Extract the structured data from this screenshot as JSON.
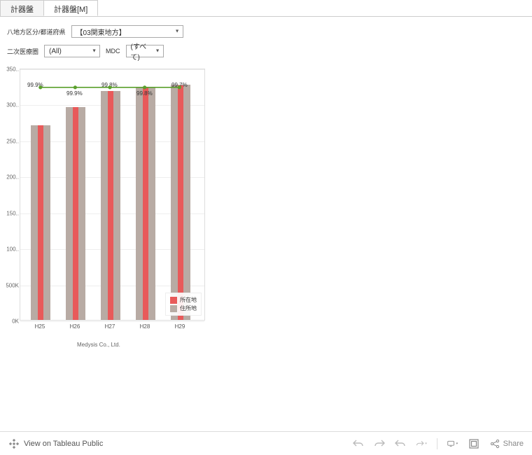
{
  "tabs": [
    {
      "label": "計器盤",
      "active": false
    },
    {
      "label": "計器盤[M]",
      "active": true
    }
  ],
  "filters": {
    "region_label": "八地方区分/都道府県",
    "region_value": "【03関東地方】",
    "secondary_label": "二次医療圏",
    "secondary_value": "(All)",
    "mdc_label": "MDC",
    "mdc_value": "(すべて)"
  },
  "chart_data": {
    "type": "bar",
    "categories": [
      "H25",
      "H26",
      "H27",
      "H28",
      "H29"
    ],
    "series": [
      {
        "name": "所在地",
        "color": "#e85a5a",
        "values": [
          278000,
          304000,
          327000,
          333000,
          335000
        ]
      },
      {
        "name": "住所地",
        "color": "#b8aba4",
        "values": [
          278500,
          304500,
          327500,
          333500,
          336000
        ]
      }
    ],
    "line_percent": [
      99.9,
      99.9,
      99.8,
      99.8,
      99.7
    ],
    "ylim": [
      0,
      360000
    ],
    "y_ticks": [
      "0K",
      "500K",
      "100..",
      "150..",
      "200..",
      "250..",
      "300..",
      "350.."
    ],
    "legend": [
      "所在地",
      "住所地"
    ]
  },
  "credit": "Medysis Co., Ltd.",
  "toolbar": {
    "view_label": "View on Tableau Public",
    "share_label": "Share"
  }
}
